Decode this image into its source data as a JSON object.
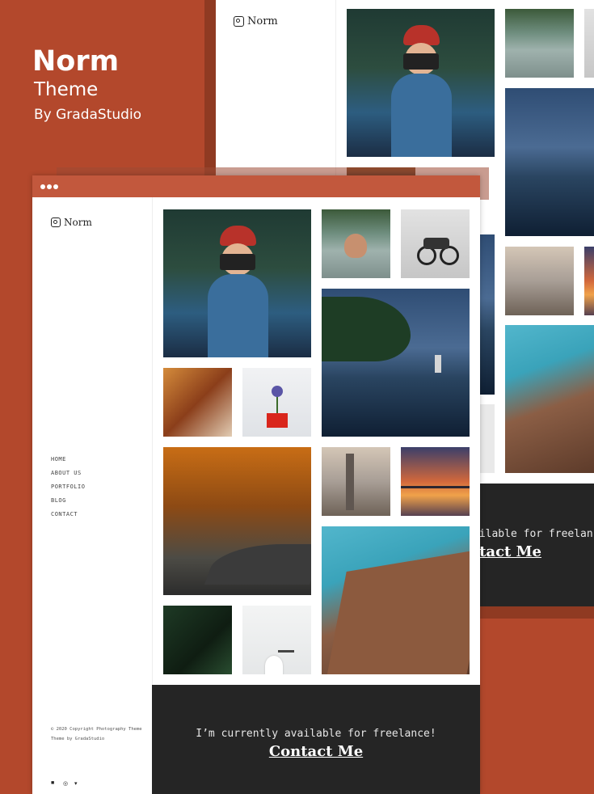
{
  "hero": {
    "title": "Norm",
    "subtitle": "Theme",
    "byline": "By GradaStudio"
  },
  "site": {
    "logo_text": "Norm",
    "nav": [
      "HOME",
      "ABOUT US",
      "PORTFOLIO",
      "BLOG",
      "CONTACT"
    ],
    "copyright": "© 2020 Copyright Photography Theme Theme by GradaStudio",
    "social_icons": [
      "facebook-icon",
      "instagram-icon",
      "twitter-icon"
    ]
  },
  "footer": {
    "tagline": "I’m currently available for freelance!",
    "link": "Contact Me"
  },
  "back_footer": {
    "tagline_fragment": "ailable for freelanc",
    "link_fragment": "ntact Me"
  },
  "colors": {
    "background": "#b3482c",
    "window_bar": "#c2583d",
    "footer": "#252525"
  }
}
